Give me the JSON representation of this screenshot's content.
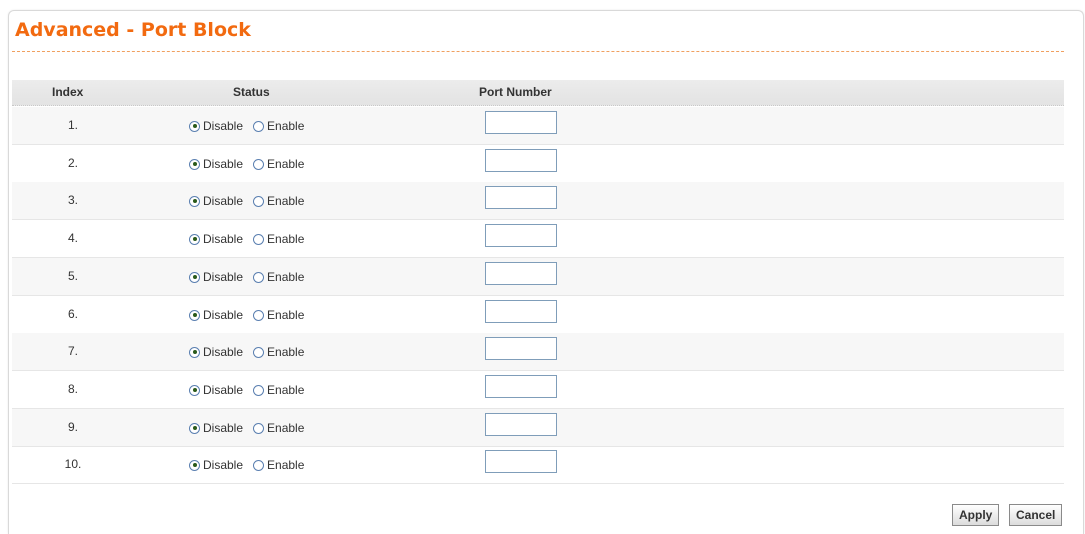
{
  "page": {
    "title": "Advanced - Port Block"
  },
  "table": {
    "headers": {
      "index": "Index",
      "status": "Status",
      "port_number": "Port Number"
    },
    "rows": [
      {
        "index": "1.",
        "status": "Disable",
        "port": ""
      },
      {
        "index": "2.",
        "status": "Disable",
        "port": ""
      },
      {
        "index": "3.",
        "status": "Disable",
        "port": ""
      },
      {
        "index": "4.",
        "status": "Disable",
        "port": ""
      },
      {
        "index": "5.",
        "status": "Disable",
        "port": ""
      },
      {
        "index": "6.",
        "status": "Disable",
        "port": ""
      },
      {
        "index": "7.",
        "status": "Disable",
        "port": ""
      },
      {
        "index": "8.",
        "status": "Disable",
        "port": ""
      },
      {
        "index": "9.",
        "status": "Disable",
        "port": ""
      },
      {
        "index": "10.",
        "status": "Disable",
        "port": ""
      }
    ],
    "options": {
      "disable": "Disable",
      "enable": "Enable"
    }
  },
  "buttons": {
    "apply": "Apply",
    "cancel": "Cancel"
  },
  "colors": {
    "title": "#f26a10",
    "title_rule": "#f0a060",
    "header_bg": "#e8e8e8",
    "alt_row_bg": "#f7f7f7"
  }
}
